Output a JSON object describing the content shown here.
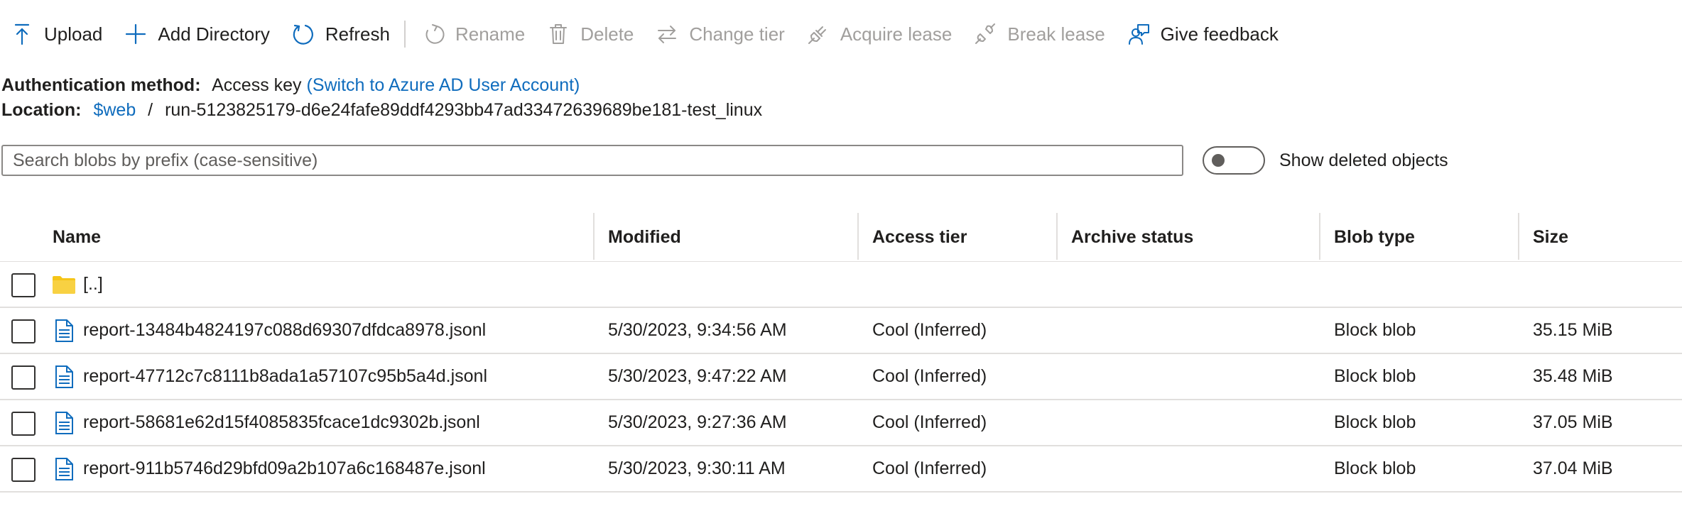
{
  "toolbar": {
    "upload": "Upload",
    "add_directory": "Add Directory",
    "refresh": "Refresh",
    "rename": "Rename",
    "delete": "Delete",
    "change_tier": "Change tier",
    "acquire_lease": "Acquire lease",
    "break_lease": "Break lease",
    "give_feedback": "Give feedback"
  },
  "auth": {
    "label": "Authentication method:",
    "value": "Access key",
    "switch_link": "(Switch to Azure AD User Account)"
  },
  "location": {
    "label": "Location:",
    "container": "$web",
    "separator": "/",
    "path": "run-5123825179-d6e24fafe89ddf4293bb47ad33472639689be181-test_linux"
  },
  "search": {
    "placeholder": "Search blobs by prefix (case-sensitive)",
    "value": ""
  },
  "toggle": {
    "label": "Show deleted objects",
    "on": false
  },
  "table": {
    "columns": {
      "name": "Name",
      "modified": "Modified",
      "access_tier": "Access tier",
      "archive_status": "Archive status",
      "blob_type": "Blob type",
      "size": "Size"
    },
    "parent_row": {
      "name": "[..]"
    },
    "rows": [
      {
        "name": "report-13484b4824197c088d69307dfdca8978.jsonl",
        "modified": "5/30/2023, 9:34:56 AM",
        "access_tier": "Cool (Inferred)",
        "archive_status": "",
        "blob_type": "Block blob",
        "size": "35.15 MiB"
      },
      {
        "name": "report-47712c7c8111b8ada1a57107c95b5a4d.jsonl",
        "modified": "5/30/2023, 9:47:22 AM",
        "access_tier": "Cool (Inferred)",
        "archive_status": "",
        "blob_type": "Block blob",
        "size": "35.48 MiB"
      },
      {
        "name": "report-58681e62d15f4085835fcace1dc9302b.jsonl",
        "modified": "5/30/2023, 9:27:36 AM",
        "access_tier": "Cool (Inferred)",
        "archive_status": "",
        "blob_type": "Block blob",
        "size": "37.05 MiB"
      },
      {
        "name": "report-911b5746d29bfd09a2b107a6c168487e.jsonl",
        "modified": "5/30/2023, 9:30:11 AM",
        "access_tier": "Cool (Inferred)",
        "archive_status": "",
        "blob_type": "Block blob",
        "size": "37.04 MiB"
      }
    ]
  },
  "colors": {
    "accent": "#0f6cbd",
    "disabled": "#a19f9d",
    "folder": "#f5c518",
    "divider": "#e1dfdd"
  },
  "icons": {
    "upload": "upload-icon",
    "add_directory": "plus-icon",
    "refresh": "refresh-icon",
    "rename": "rename-icon",
    "delete": "trash-icon",
    "change_tier": "swap-arrows-icon",
    "acquire_lease": "plug-icon",
    "break_lease": "broken-plug-icon",
    "give_feedback": "feedback-person-icon",
    "folder": "folder-icon",
    "file": "document-icon"
  }
}
